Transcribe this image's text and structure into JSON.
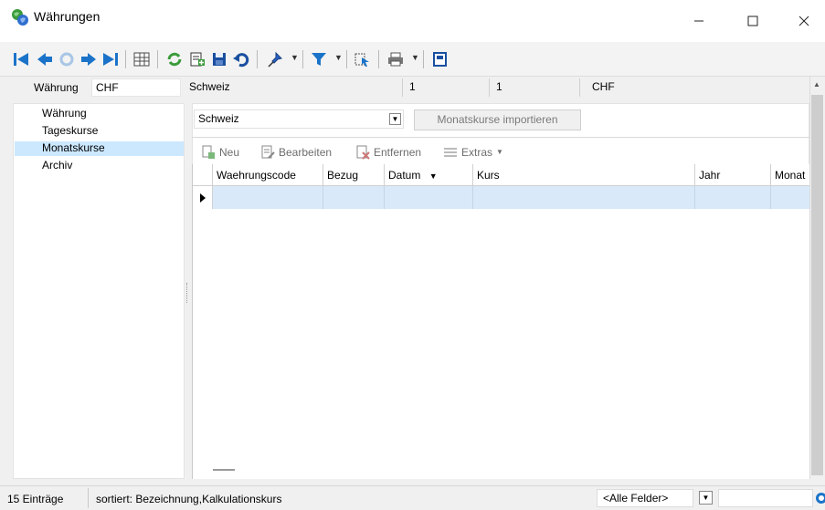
{
  "window": {
    "title": "Währungen"
  },
  "header": {
    "currency_label": "Währung",
    "currency_code": "CHF",
    "country": "Schweiz",
    "value1": "1",
    "value2": "1",
    "code_display": "CHF"
  },
  "nav": {
    "items": [
      {
        "label": "Währung"
      },
      {
        "label": "Tageskurse"
      },
      {
        "label": "Monatskurse"
      },
      {
        "label": "Archiv"
      }
    ]
  },
  "main": {
    "country_select": "Schweiz",
    "import_button": "Monatskurse importieren"
  },
  "gridtoolbar": {
    "new": "Neu",
    "edit": "Bearbeiten",
    "remove": "Entfernen",
    "extras": "Extras"
  },
  "grid": {
    "columns": [
      "Waehrungscode",
      "Bezug",
      "Datum",
      "Kurs",
      "Jahr",
      "Monat"
    ]
  },
  "statusbar": {
    "count": "15 Einträge",
    "sorted": "sortiert: Bezeichnung,Kalkulationskurs",
    "filter": "<Alle Felder>"
  },
  "colors": {
    "selection": "#cce8ff",
    "accent": "#1a73c9"
  }
}
